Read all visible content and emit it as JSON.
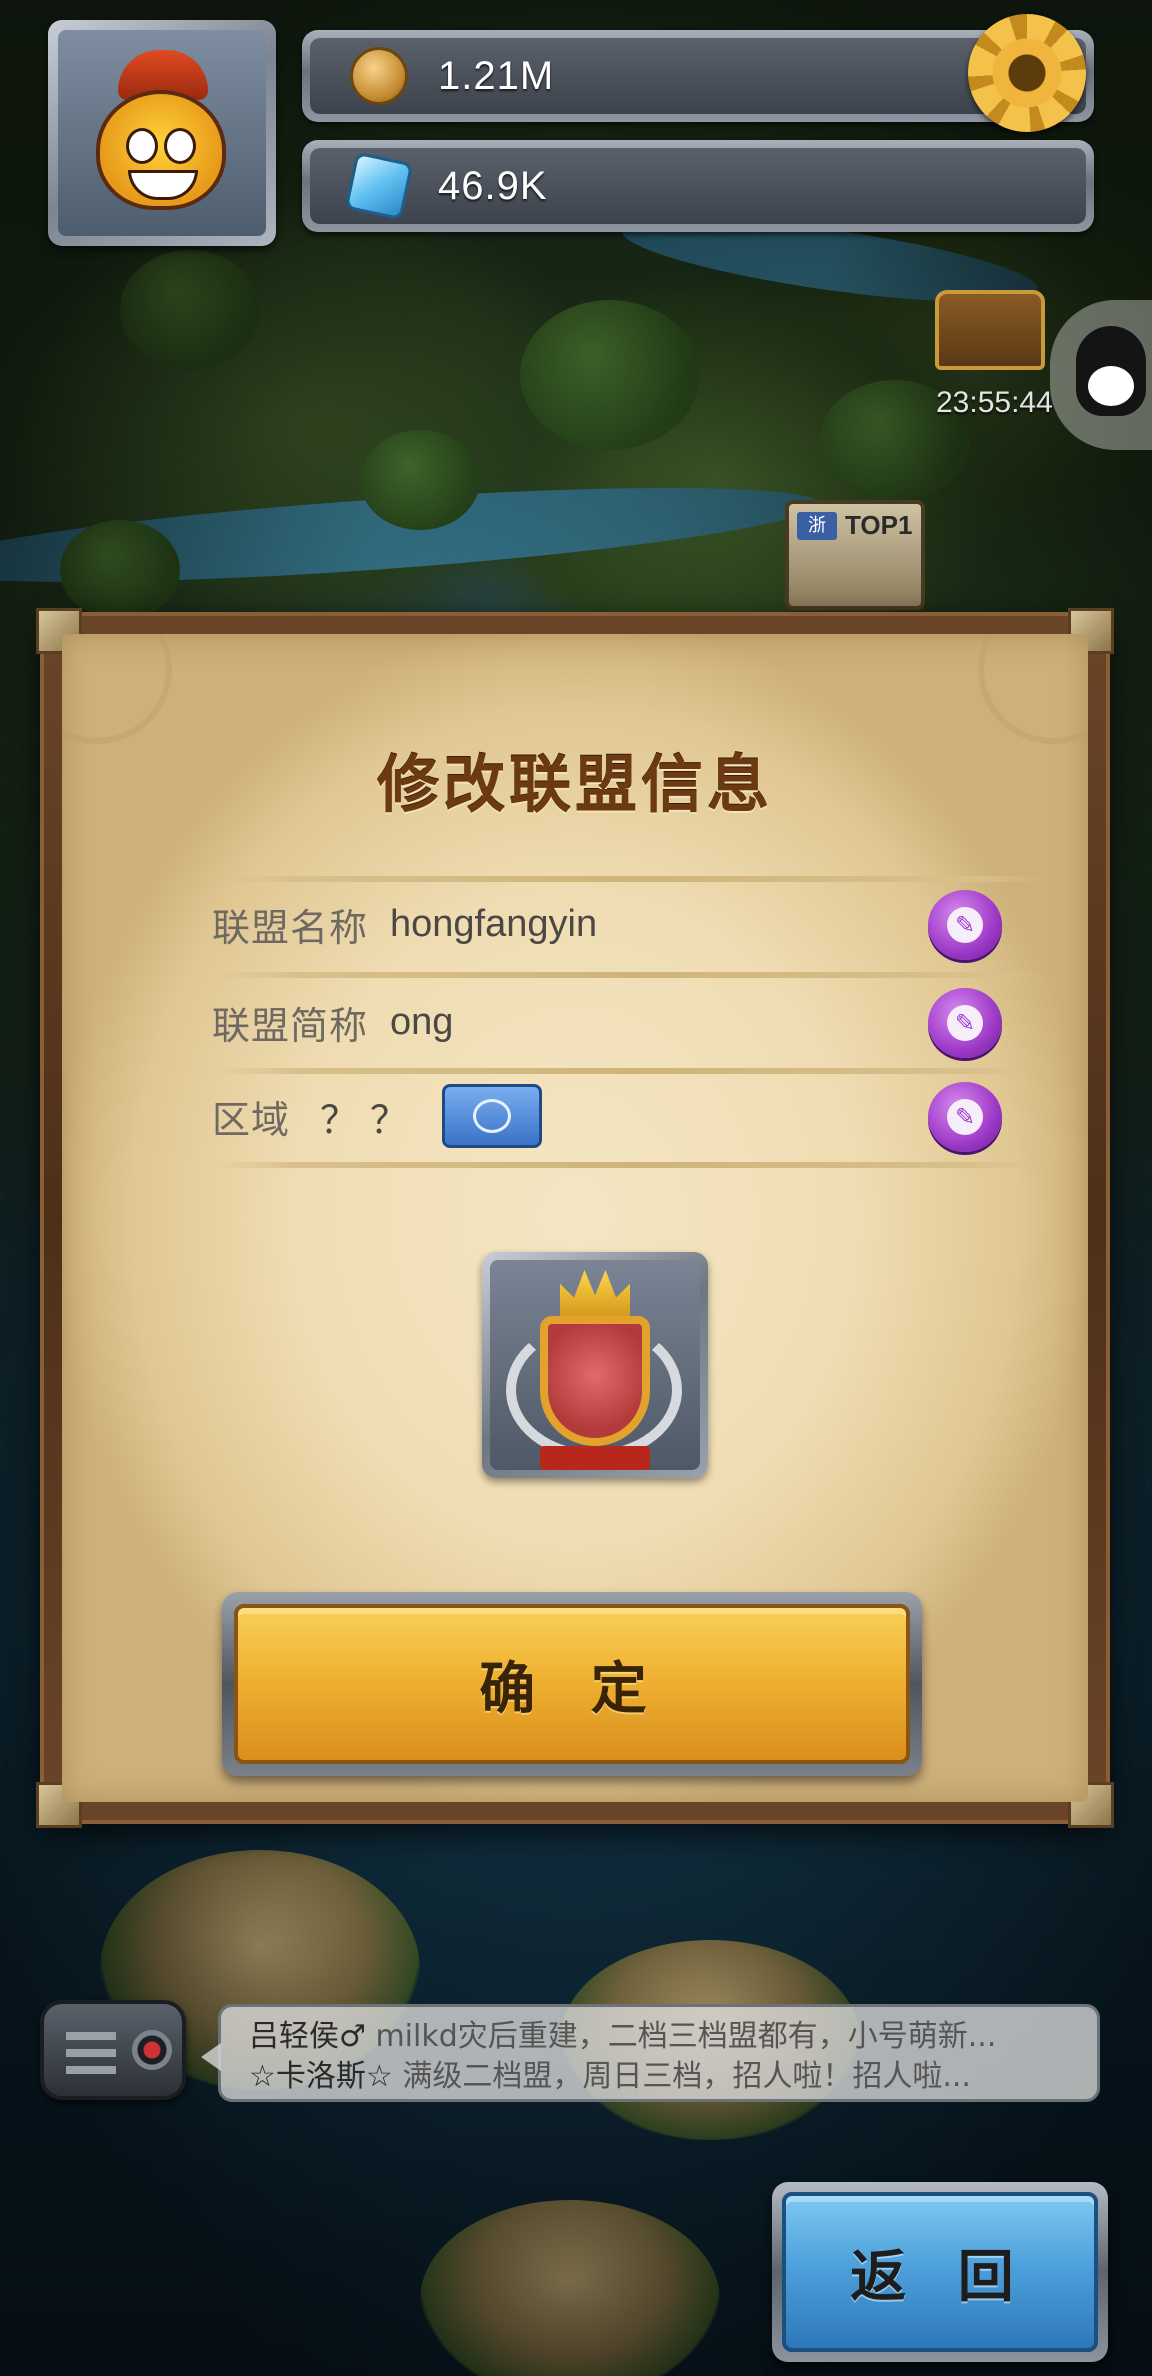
{
  "hud": {
    "coins": "1.21M",
    "gems": "46.9K",
    "timer": "23:55:44",
    "map_badge": "TOP1",
    "map_badge_region": "浙"
  },
  "dialog": {
    "title": "修改联盟信息",
    "rows": [
      {
        "label": "联盟名称",
        "value": "hongfangyin"
      },
      {
        "label": "联盟简称",
        "value": "ong"
      },
      {
        "label": "区域",
        "value": "？？"
      }
    ],
    "confirm_label": "确 定"
  },
  "chat": {
    "messages": [
      {
        "sender": "吕轻侯♂",
        "text": "milkd灾后重建，二档三档盟都有，小号萌新..."
      },
      {
        "sender": "☆卡洛斯☆",
        "text": "满级二档盟，周日三档，招人啦！招人啦..."
      }
    ]
  },
  "back_label": "返 回",
  "colors": {
    "confirm": "#f0b232",
    "back": "#4ea1dc",
    "edit": "#9d39c7",
    "title": "#6b3a12"
  }
}
